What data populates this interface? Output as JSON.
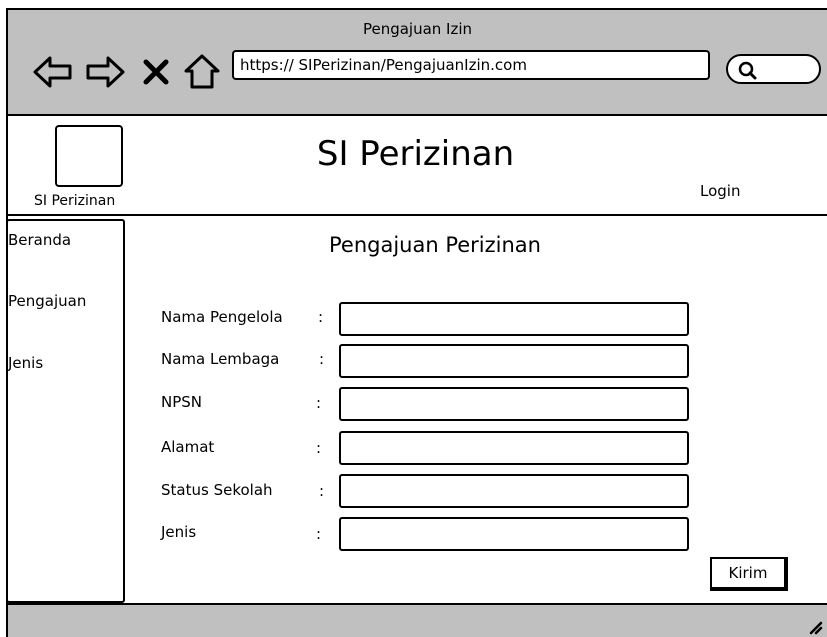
{
  "window": {
    "title": "Pengajuan Izin"
  },
  "browser": {
    "url": "https:// SIPerizinan/PengajuanIzin.com",
    "icons": [
      "back-arrow-icon",
      "forward-arrow-icon",
      "close-x-icon",
      "home-icon",
      "search-icon"
    ]
  },
  "header": {
    "logo_caption": "SI Perizinan",
    "site_title": "SI Perizinan",
    "login_label": "Login"
  },
  "sidebar": {
    "items": [
      {
        "label": "Beranda"
      },
      {
        "label": "Pengajuan"
      },
      {
        "label": "Jenis"
      }
    ]
  },
  "form": {
    "title": "Pengajuan Perizinan",
    "colon": ":",
    "fields": [
      {
        "label": "Nama Pengelola",
        "value": ""
      },
      {
        "label": "Nama Lembaga",
        "value": ""
      },
      {
        "label": "NPSN",
        "value": ""
      },
      {
        "label": "Alamat",
        "value": ""
      },
      {
        "label": "Status Sekolah",
        "value": ""
      },
      {
        "label": "Jenis",
        "value": ""
      }
    ],
    "submit_label": "Kirim"
  }
}
